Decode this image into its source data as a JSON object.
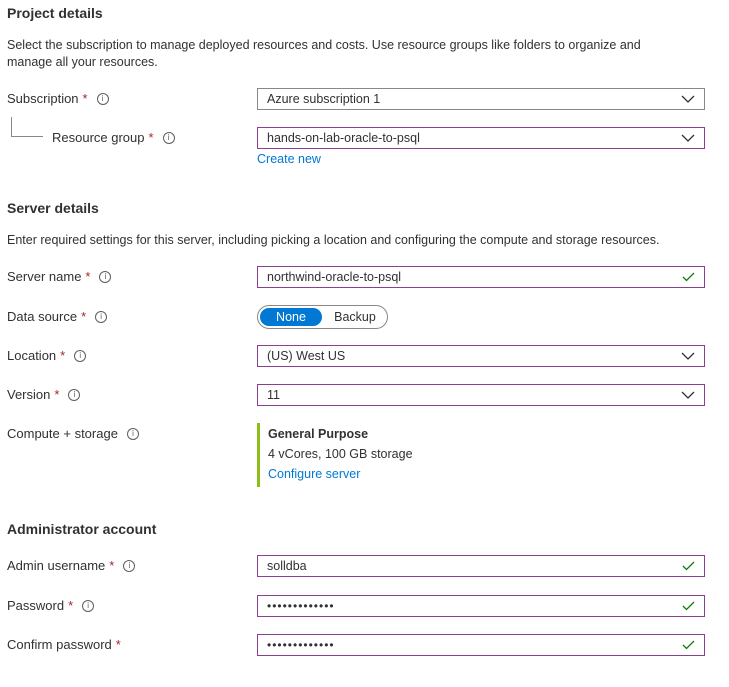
{
  "project": {
    "title": "Project details",
    "description": "Select the subscription to manage deployed resources and costs. Use resource groups like folders to organize and manage all your resources.",
    "subscription": {
      "label": "Subscription",
      "required": "*",
      "value": "Azure subscription 1"
    },
    "resource_group": {
      "label": "Resource group",
      "required": "*",
      "value": "hands-on-lab-oracle-to-psql",
      "create_new": "Create new"
    }
  },
  "server": {
    "title": "Server details",
    "description": "Enter required settings for this server, including picking a location and configuring the compute and storage resources.",
    "server_name": {
      "label": "Server name",
      "required": "*",
      "value": "northwind-oracle-to-psql"
    },
    "data_source": {
      "label": "Data source",
      "required": "*",
      "options": [
        "None",
        "Backup"
      ],
      "selected": "None"
    },
    "location": {
      "label": "Location",
      "required": "*",
      "value": "(US) West US"
    },
    "version": {
      "label": "Version",
      "required": "*",
      "value": "11"
    },
    "compute": {
      "label": "Compute + storage",
      "tier": "General Purpose",
      "spec": "4 vCores, 100 GB storage",
      "configure": "Configure server"
    }
  },
  "admin": {
    "title": "Administrator account",
    "username": {
      "label": "Admin username",
      "required": "*",
      "value": "solldba"
    },
    "password": {
      "label": "Password",
      "required": "*",
      "value": "•••••••••••••"
    },
    "confirm": {
      "label": "Confirm password",
      "required": "*",
      "value": "•••••••••••••"
    }
  },
  "colors": {
    "accent": "#0078d4",
    "required": "#a4262c",
    "valid": "#107c10",
    "tier_bar": "#8cbd18",
    "focus_border": "#8a3f8f"
  },
  "icons": {
    "info": "info-icon",
    "dropdown": "chevron-down-icon",
    "valid": "checkmark-icon"
  }
}
